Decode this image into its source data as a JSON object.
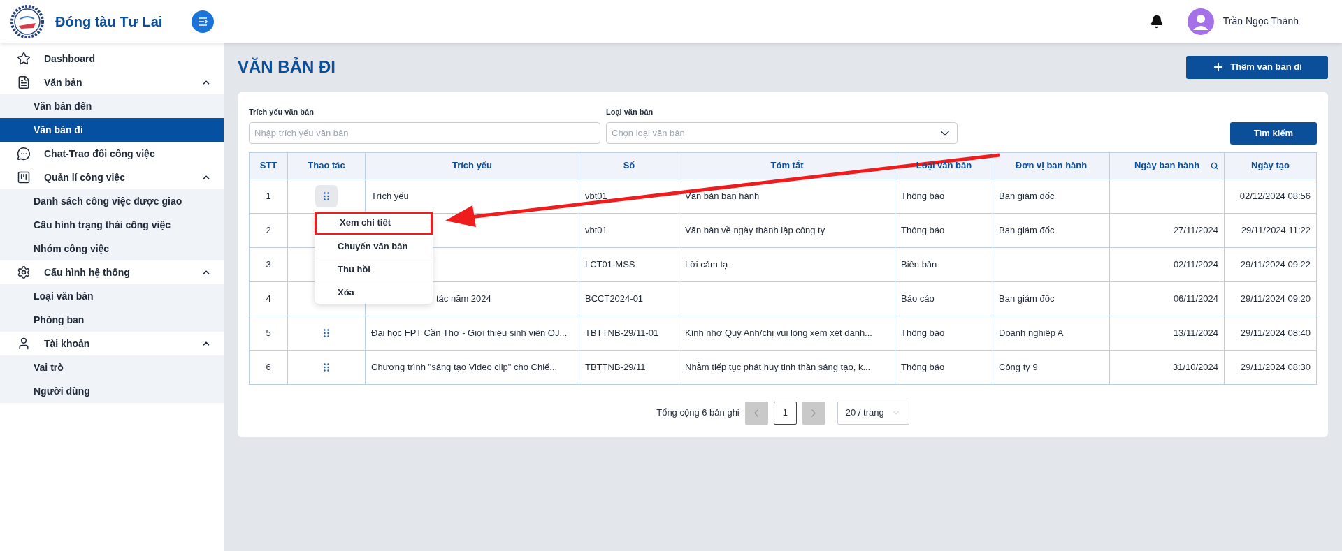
{
  "app": {
    "name": "Đóng tàu Tư Lai"
  },
  "user": {
    "name": "Trần Ngọc Thành"
  },
  "sidebar": {
    "items": [
      {
        "label": "Dashboard"
      },
      {
        "label": "Văn bản",
        "expanded": true,
        "children": [
          {
            "label": "Văn bản đến",
            "selected": false
          },
          {
            "label": "Văn bản đi",
            "selected": true
          }
        ]
      },
      {
        "label": "Chat-Trao đổi công việc"
      },
      {
        "label": "Quản lí công việc",
        "expanded": true,
        "children": [
          {
            "label": "Danh sách công việc được giao",
            "selected": false
          },
          {
            "label": "Cấu hình trạng thái công việc",
            "selected": false
          },
          {
            "label": "Nhóm công việc",
            "selected": false
          }
        ]
      },
      {
        "label": "Cấu hình hệ thống",
        "expanded": true,
        "children": [
          {
            "label": "Loại văn bản",
            "selected": false
          },
          {
            "label": "Phòng ban",
            "selected": false
          }
        ]
      },
      {
        "label": "Tài khoản",
        "expanded": true,
        "children": [
          {
            "label": "Vai trò",
            "selected": false
          },
          {
            "label": "Người dùng",
            "selected": false
          }
        ]
      }
    ]
  },
  "page": {
    "title": "VĂN BẢN ĐI",
    "add_button": "Thêm văn bản đi"
  },
  "filters": {
    "fields": [
      {
        "label": "Trích yếu văn bản",
        "placeholder": "Nhập trích yếu văn bản",
        "kind": "text"
      },
      {
        "label": "Loại văn bản",
        "placeholder": "Chọn loại văn bản",
        "kind": "select"
      }
    ],
    "search_button": "Tìm kiếm"
  },
  "table": {
    "columns": [
      {
        "label": "STT"
      },
      {
        "label": "Thao tác"
      },
      {
        "label": "Trích yếu"
      },
      {
        "label": "Số"
      },
      {
        "label": "Tóm tắt"
      },
      {
        "label": "Loại văn bản"
      },
      {
        "label": "Đơn vị ban hành"
      },
      {
        "label": "Ngày ban hành",
        "searchable": true
      },
      {
        "label": "Ngày tạo"
      }
    ],
    "rows": [
      {
        "stt": "1",
        "trich_yeu": "Trích yếu",
        "so": "vbt01",
        "tom_tat": "Văn bản ban hành",
        "loai": "Thông báo",
        "don_vi": "Ban giám đốc",
        "ngay_tao": "02/12/2024 08:56",
        "menu_open": true
      },
      {
        "stt": "2",
        "so": "vbt01",
        "tom_tat": "Văn bản về ngày thành lập công ty",
        "loai": "Thông báo",
        "don_vi": "Ban giám đốc",
        "ngay_ban_hanh": "27/11/2024",
        "ngay_tao": "29/11/2024 11:22",
        "menu_open": false
      },
      {
        "stt": "3",
        "so": "LCT01-MSS",
        "tom_tat": "Lời cảm tạ",
        "loai": "Biên bản",
        "ngay_ban_hanh": "02/11/2024",
        "ngay_tao": "29/11/2024 09:22",
        "menu_open": false
      },
      {
        "stt": "4",
        "trich_yeu": "tác năm 2024",
        "so": "BCCT2024-01",
        "loai": "Báo cáo",
        "don_vi": "Ban giám đốc",
        "ngay_ban_hanh": "06/11/2024",
        "ngay_tao": "29/11/2024 09:20",
        "menu_open": false
      },
      {
        "stt": "5",
        "trich_yeu": "Đại học FPT Cần Thơ - Giới thiệu sinh viên OJ...",
        "so": "TBTTNB-29/11-01",
        "tom_tat": "Kính nhờ Quý Anh/chị vui lòng xem xét danh...",
        "loai": "Thông báo",
        "don_vi": "Doanh nghiệp A",
        "ngay_ban_hanh": "13/11/2024",
        "ngay_tao": "29/11/2024 08:40",
        "menu_open": false
      },
      {
        "stt": "6",
        "trich_yeu": "Chương trình \"sáng tạo Video clip\" cho Chiế...",
        "so": "TBTTNB-29/11",
        "tom_tat": "Nhằm tiếp tục phát huy tinh thần sáng tạo, k...",
        "loai": "Thông báo",
        "don_vi": "Công ty 9",
        "ngay_ban_hanh": "31/10/2024",
        "ngay_tao": "29/11/2024 08:30",
        "menu_open": false
      }
    ]
  },
  "action_menu": {
    "items": [
      {
        "label": "Xem chi tiết",
        "highlighted": true
      },
      {
        "label": "Chuyển văn bản",
        "highlighted": false
      },
      {
        "label": "Thu hồi",
        "highlighted": false
      },
      {
        "label": "Xóa",
        "highlighted": false
      }
    ]
  },
  "pagination": {
    "total": "Tổng cộng 6 bản ghi",
    "prev_disabled": true,
    "pages": [
      {
        "label": "1",
        "selected": true
      }
    ],
    "next_disabled": true,
    "page_size": "20 / trang"
  }
}
